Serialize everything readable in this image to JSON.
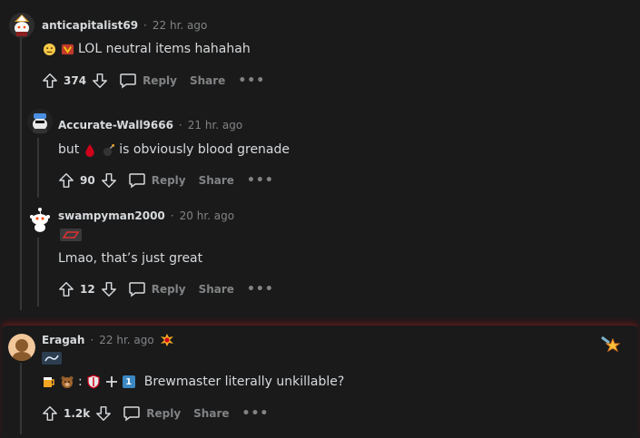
{
  "comments": [
    {
      "username": "anticapitalist69",
      "separator": "·",
      "time": "22 hr. ago",
      "body": "LOL neutral items hahahah",
      "votes": "374",
      "reply_label": "Reply",
      "share_label": "Share",
      "more_label": "•••"
    },
    {
      "username": "Accurate-Wall9666",
      "separator": "·",
      "time": "21 hr. ago",
      "body_before": "but",
      "body_after": "is obviously blood grenade",
      "votes": "90",
      "reply_label": "Reply",
      "share_label": "Share",
      "more_label": "•••"
    },
    {
      "username": "swampyman2000",
      "separator": "·",
      "time": "20 hr. ago",
      "body": "Lmao, that’s just great",
      "votes": "12",
      "reply_label": "Reply",
      "share_label": "Share",
      "more_label": "•••"
    },
    {
      "username": "Eragah",
      "separator": "·",
      "time": "22 hr. ago",
      "body_symbols": ":",
      "body_badge": "1",
      "body": "Brewmaster literally unkillable?",
      "votes": "1.2k",
      "reply_label": "Reply",
      "share_label": "Share",
      "more_label": "•••"
    }
  ],
  "colors": {
    "background": "#1a1a1b",
    "text": "#d7dadc",
    "muted": "#818384",
    "thread_line": "#343536",
    "highlight_border": "#4b1a1a"
  }
}
